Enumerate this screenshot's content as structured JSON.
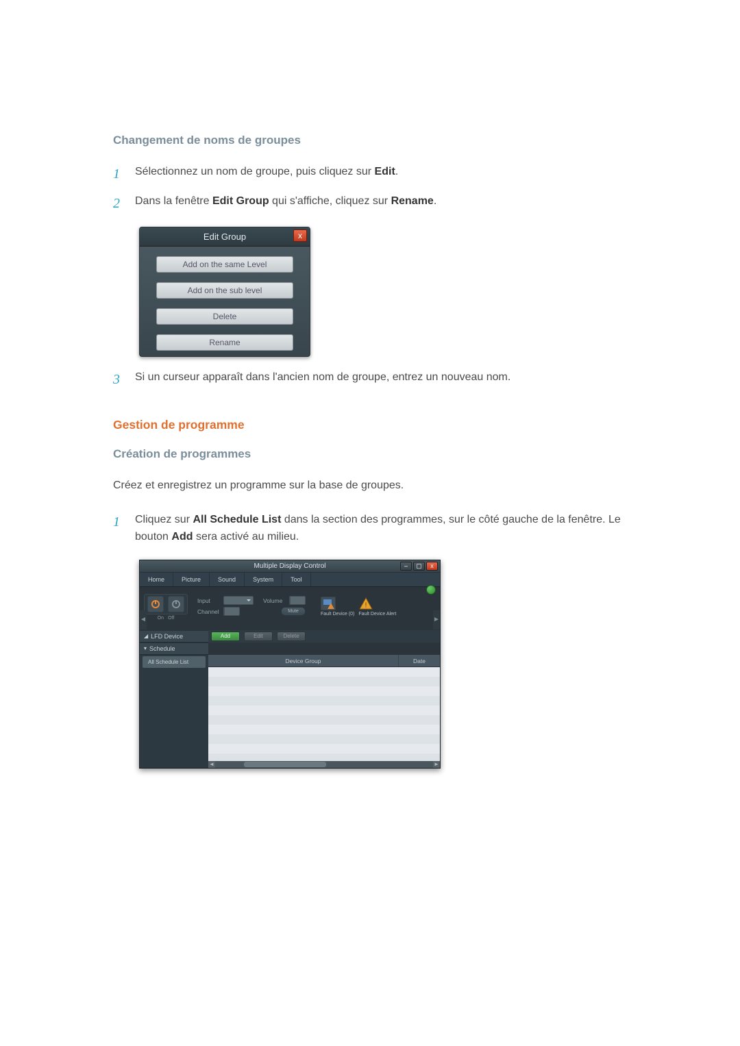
{
  "section1": {
    "title": "Changement de noms de groupes",
    "step1_a": "Sélectionnez un nom de groupe, puis cliquez sur ",
    "step1_b": "Edit",
    "step1_c": ".",
    "step2_a": "Dans la fenêtre ",
    "step2_b": "Edit Group",
    "step2_c": " qui s'affiche, cliquez sur ",
    "step2_d": "Rename",
    "step2_e": ".",
    "step3": "Si un curseur apparaît dans l'ancien nom de groupe, entrez un nouveau nom."
  },
  "editDialog": {
    "title": "Edit Group",
    "close": "x",
    "buttons": [
      "Add on the same Level",
      "Add on the sub level",
      "Delete",
      "Rename"
    ]
  },
  "section2": {
    "orange": "Gestion de programme",
    "sub": "Création de programmes",
    "para": "Créez et enregistrez un programme sur la base de groupes.",
    "step1_a": "Cliquez sur ",
    "step1_b": "All Schedule List",
    "step1_c": " dans la section des programmes, sur le côté gauche de la fenêtre. Le bouton ",
    "step1_d": "Add",
    "step1_e": " sera activé au milieu."
  },
  "mdc": {
    "title": "Multiple Display Control",
    "tabs": [
      "Home",
      "Picture",
      "Sound",
      "System",
      "Tool"
    ],
    "power_on": "On",
    "power_off": "Off",
    "input_label": "Input",
    "channel_label": "Channel",
    "volume_label": "Volume",
    "mute_label": "Mute",
    "fault1": "Fault Device (0)",
    "fault2": "Fault Device Alert",
    "side1": "LFD Device",
    "side2": "Schedule",
    "tree_item": "All Schedule List",
    "btn_add": "Add",
    "btn_edit": "Edit",
    "btn_delete": "Delete",
    "col1": "Device Group",
    "col2": "Date"
  }
}
